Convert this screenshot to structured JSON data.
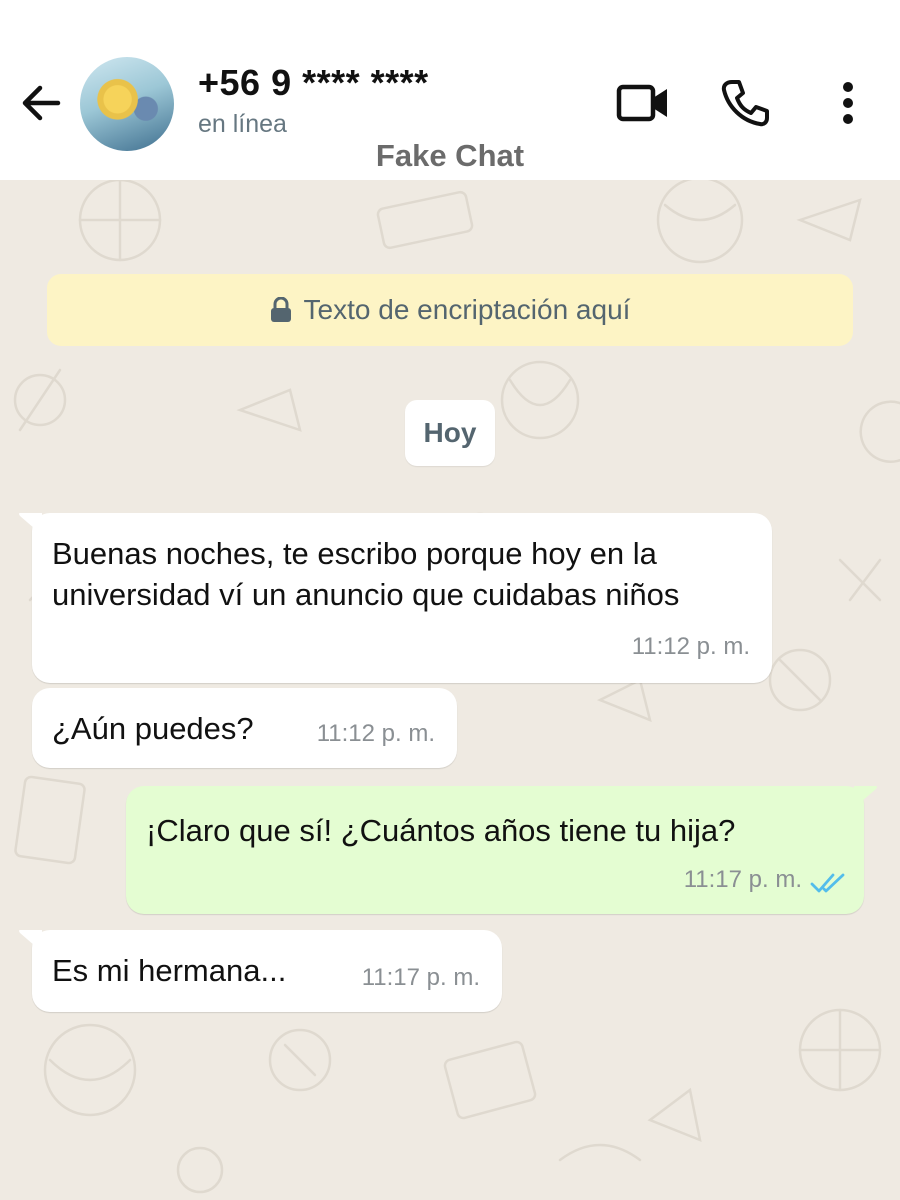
{
  "header": {
    "contact_name": "+56 9 **** ****",
    "status": "en línea",
    "watermark": "Fake Chat",
    "icons": [
      "arrow-left-icon",
      "video-camera-icon",
      "phone-icon",
      "more-vertical-icon"
    ]
  },
  "chat": {
    "encryption_notice": "Texto de encriptación aquí",
    "date_label": "Hoy",
    "messages": [
      {
        "direction": "incoming",
        "text": "Buenas noches, te escribo porque hoy en la universidad ví un anuncio que cuidabas niños",
        "time": "11:12 p. m."
      },
      {
        "direction": "incoming",
        "text": "¿Aún puedes?",
        "time": "11:12 p. m."
      },
      {
        "direction": "outgoing",
        "text": "¡Claro que sí! ¿Cuántos años tiene tu hija?",
        "time": "11:17 p. m.",
        "status": "read"
      },
      {
        "direction": "incoming",
        "text": "Es mi hermana...",
        "time": "11:17 p. m."
      }
    ]
  },
  "colors": {
    "chat_background": "#efeae2",
    "incoming_bubble": "#ffffff",
    "outgoing_bubble": "#e4fdd2",
    "encryption_banner": "#fdf4c5",
    "read_ticks": "#53bdeb"
  }
}
